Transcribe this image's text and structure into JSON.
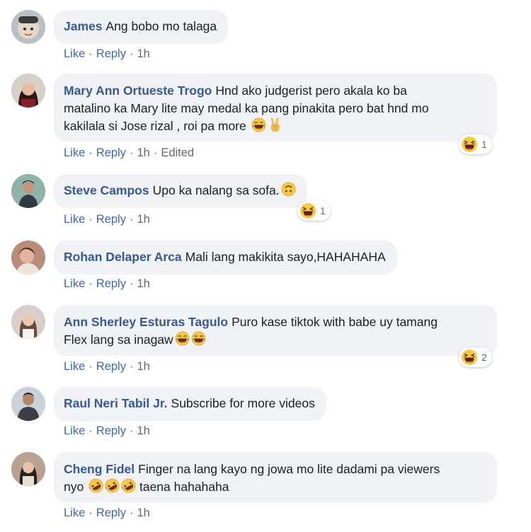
{
  "actions": {
    "like": "Like",
    "reply": "Reply",
    "separator": "·"
  },
  "comments": [
    {
      "author": "James",
      "text": "Ang bobo mo talaga",
      "time": "1h"
    },
    {
      "author": "Mary Ann Ortueste Trogo",
      "text_line1": "Hnd ako judgerist pero akala ko ba",
      "text_line2": "matalino ka Mary lite may medal ka pang pinakita pero bat hnd mo",
      "text_line3": "kakilala si Jose rizal , roi pa more",
      "emojis": [
        "laughing-tears-emoji",
        "victory-hand-emoji"
      ],
      "time": "1h",
      "edited": "Edited",
      "reaction_icon": "haha-reaction-icon",
      "reaction_count": "1"
    },
    {
      "author": "Steve Campos",
      "text": "Upo ka nalang sa sofa.",
      "emojis": [
        "upside-down-face-emoji"
      ],
      "time": "1h",
      "reaction_icon": "haha-reaction-icon",
      "reaction_count": "1"
    },
    {
      "author": "Rohan Delaper Arca",
      "text": "Mali lang makikita sayo,HAHAHAHA",
      "time": "1h"
    },
    {
      "author": "Ann Sherley Esturas Tagulo",
      "text_line1": "Puro kase tiktok with babe uy tamang",
      "text_line2": "Flex lang sa inagaw",
      "emojis": [
        "laughing-tears-emoji",
        "laughing-tears-emoji"
      ],
      "time": "1h",
      "reaction_icon": "haha-reaction-icon",
      "reaction_count": "2"
    },
    {
      "author": "Raul Neri Tabil Jr.",
      "text": "Subscribe for more videos",
      "time": "1h"
    },
    {
      "author": "Cheng Fidel",
      "text_line1": "Finger na lang kayo ng jowa mo lite dadami pa viewers",
      "text_line2_pre": "nyo",
      "text_line2_post": "taena hahahaha",
      "emojis": [
        "rolling-laughing-emoji",
        "rolling-laughing-emoji",
        "rolling-laughing-emoji"
      ],
      "time": "1h"
    }
  ],
  "colors": {
    "author": "#385898",
    "link": "#4267b2",
    "meta": "#65676b",
    "bubble": "#f0f2f5",
    "text": "#1c1e21"
  }
}
